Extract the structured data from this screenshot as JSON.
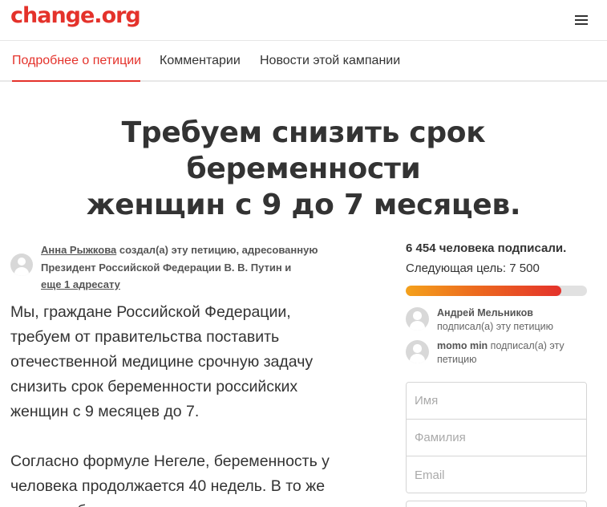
{
  "header": {
    "logo": "change.org",
    "menu_icon": "hamburger-menu-icon"
  },
  "tabs": [
    {
      "label": "Подробнее о петиции",
      "active": true
    },
    {
      "label": "Комментарии",
      "active": false
    },
    {
      "label": "Новости этой кампании",
      "active": false
    }
  ],
  "petition": {
    "title_line1": "Требуем снизить срок беременности",
    "title_line2": "женщин с 9 до 7 месяцев.",
    "author": {
      "name": "Анна Рыжкова",
      "created_text": " создал(а) эту петицию, адресованную",
      "recipient_line": "Президент Российской Федерации В. В. Путин и",
      "more_recipients": "еще 1 адресату"
    },
    "body_lines": [
      "Мы, граждане Российской Федерации,",
      "требуем от правительства поставить",
      "отечественной медицине срочную задачу",
      "снизить срок беременности российских",
      "женщин с 9 месяцев до 7.",
      "",
      "Согласно формуле Негеле, беременность у",
      "человека продолжается 40 недель. В то же",
      "время наблюдаются некоторые"
    ]
  },
  "signatures": {
    "count_text": "6 454 человека подписали.",
    "goal_text": "Следующая цель: 7 500",
    "count": 6454,
    "goal": 7500,
    "recent_signers": [
      {
        "name": "Андрей Мельников",
        "action": "подписал(а) эту петицию"
      },
      {
        "name": "momo min",
        "action": " подписал(а) эту",
        "action_line2": "петицию"
      }
    ]
  },
  "form": {
    "first_name_placeholder": "Имя",
    "last_name_placeholder": "Фамилия",
    "email_placeholder": "Email"
  },
  "colors": {
    "brand": "#e4322b",
    "progress_start": "#f4a11c",
    "progress_end": "#e4322b"
  }
}
